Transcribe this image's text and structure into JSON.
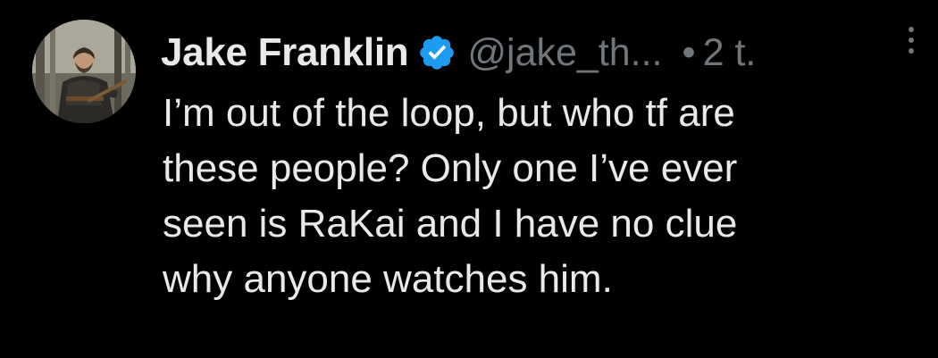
{
  "tweet": {
    "author": {
      "display_name": "Jake Franklin",
      "handle": "@jake_th...",
      "verified": true,
      "avatar": "profile-photo"
    },
    "separator": "•",
    "timestamp": "2 t.",
    "more_icon": "ellipsis-vertical-icon",
    "text_lines": [
      "I’m out of the loop, but who tf are",
      "these people? Only one I’ve ever",
      "seen is RaKai and I have no clue",
      "why anyone watches him."
    ],
    "colors": {
      "background": "#000000",
      "primary_text": "#e7e9ea",
      "secondary_text": "#71767b",
      "verified_badge": "#1d9bf0"
    }
  }
}
